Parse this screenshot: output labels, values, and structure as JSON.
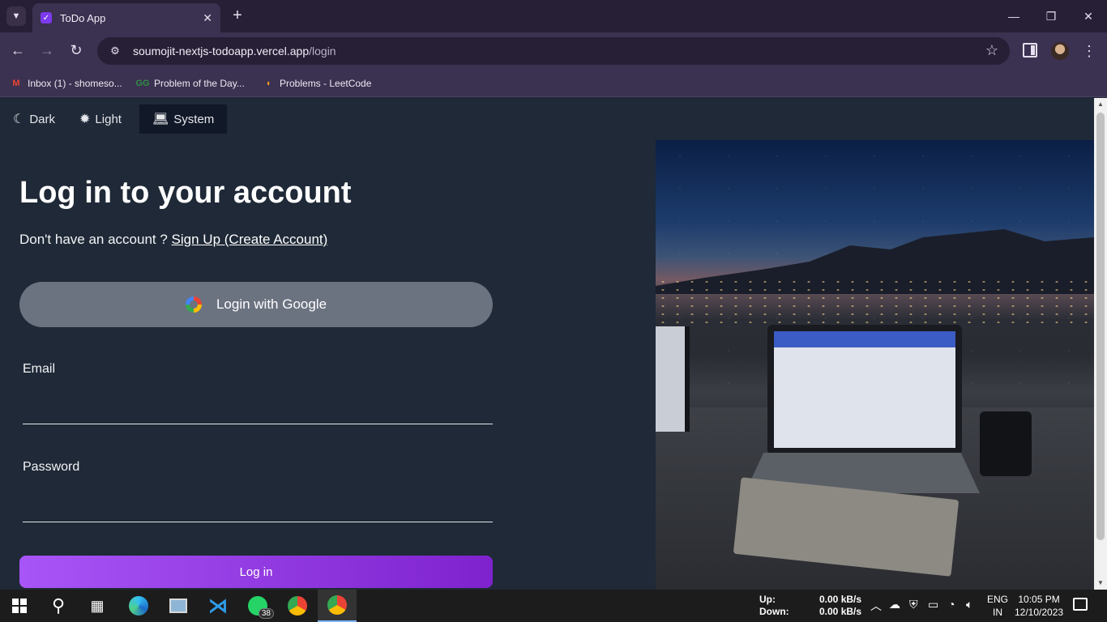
{
  "browser": {
    "tab": {
      "title": "ToDo App",
      "close_glyph": "✕"
    },
    "new_tab_glyph": "+",
    "url": {
      "host": "soumojit-nextjs-todoapp.vercel.app",
      "path": "/login"
    },
    "bookmarks": [
      {
        "label": "Inbox (1) - shomeso...",
        "icon": "gmail-icon"
      },
      {
        "label": "Problem of the Day...",
        "icon": "geeksforgeeks-icon"
      },
      {
        "label": "Problems - LeetCode",
        "icon": "leetcode-icon"
      }
    ]
  },
  "theme_switcher": {
    "options": [
      {
        "label": "Dark",
        "icon": "moon-icon"
      },
      {
        "label": "Light",
        "icon": "sun-icon"
      },
      {
        "label": "System",
        "icon": "laptop-icon",
        "active": true
      }
    ]
  },
  "login": {
    "heading": "Log in to your account",
    "signup_prompt": "Don't have an account ? ",
    "signup_link": "Sign Up (Create Account)",
    "google_button": "Login with Google",
    "email_label": "Email",
    "email_value": "",
    "password_label": "Password",
    "password_value": "",
    "submit_label": "Log in"
  },
  "taskbar": {
    "network": {
      "up_label": "Up:",
      "up_value": "0.00 kB/s",
      "down_label": "Down:",
      "down_value": "0.00 kB/s"
    },
    "language": {
      "line1": "ENG",
      "line2": "IN"
    },
    "clock": {
      "time": "10:05 PM",
      "date": "12/10/2023"
    },
    "whatsapp_badge": "38"
  },
  "colors": {
    "page_bg": "#1f2937",
    "google_button_bg": "#6b7280",
    "login_gradient_start": "#a855f7",
    "login_gradient_end": "#7e22ce",
    "browser_frame": "#3b3150"
  }
}
